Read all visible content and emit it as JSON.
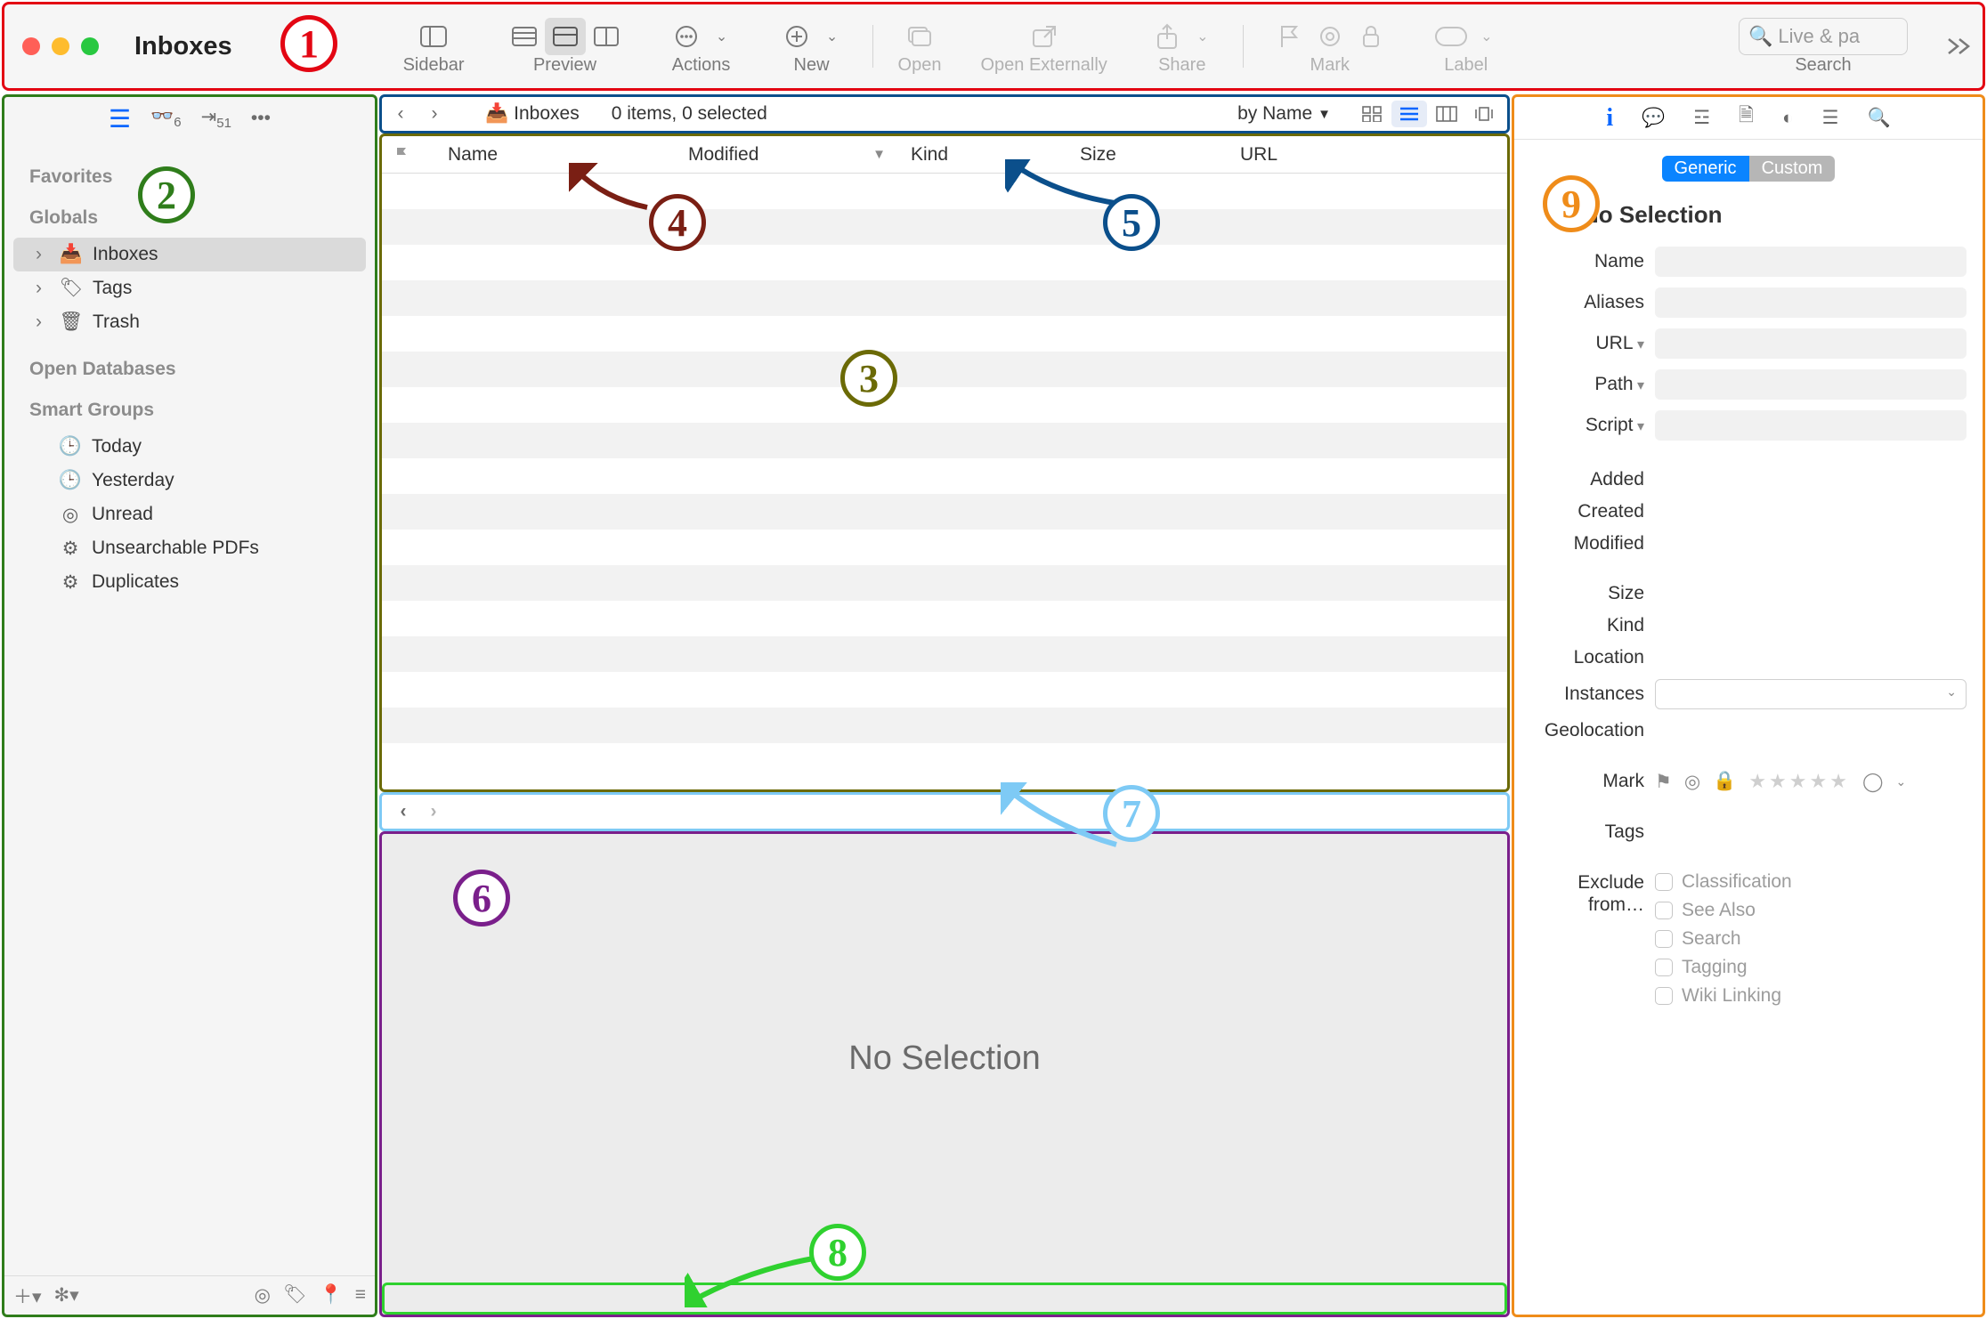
{
  "window": {
    "title": "Inboxes"
  },
  "toolbar": {
    "sidebar": "Sidebar",
    "preview": "Preview",
    "actions": "Actions",
    "new": "New",
    "open": "Open",
    "open_ext": "Open Externally",
    "share": "Share",
    "mark": "Mark",
    "label": "Label",
    "search": "Search",
    "search_placeholder": "Live & pa"
  },
  "sidebar_tabs": {
    "badge1": "6",
    "badge2": "51"
  },
  "sidebar": {
    "favorites": "Favorites",
    "globals": "Globals",
    "globals_items": [
      {
        "label": "Inboxes",
        "icon": "inbox",
        "disclosure": true,
        "selected": true
      },
      {
        "label": "Tags",
        "icon": "tag",
        "disclosure": true,
        "selected": false
      },
      {
        "label": "Trash",
        "icon": "trash",
        "disclosure": true,
        "selected": false
      }
    ],
    "open_db": "Open Databases",
    "smart": "Smart Groups",
    "smart_items": [
      {
        "label": "Today",
        "icon": "clock"
      },
      {
        "label": "Yesterday",
        "icon": "clock"
      },
      {
        "label": "Unread",
        "icon": "circle"
      },
      {
        "label": "Unsearchable PDFs",
        "icon": "gear"
      },
      {
        "label": "Duplicates",
        "icon": "gear"
      }
    ]
  },
  "pathbar": {
    "crumb": "Inboxes",
    "status": "0 items, 0 selected",
    "sort": "by Name"
  },
  "columns": {
    "flag": "",
    "name": "Name",
    "modified": "Modified",
    "kind": "Kind",
    "size": "Size",
    "url": "URL"
  },
  "preview": {
    "no_selection": "No Selection"
  },
  "inspector": {
    "generic": "Generic",
    "custom": "Custom",
    "title": "No Selection",
    "fields": {
      "name": "Name",
      "aliases": "Aliases",
      "url": "URL",
      "path": "Path",
      "script": "Script",
      "added": "Added",
      "created": "Created",
      "modified": "Modified",
      "size": "Size",
      "kind": "Kind",
      "location": "Location",
      "instances": "Instances",
      "geolocation": "Geolocation",
      "mark": "Mark",
      "tags": "Tags",
      "exclude": "Exclude from…"
    },
    "exclude_opts": [
      "Classification",
      "See Also",
      "Search",
      "Tagging",
      "Wiki Linking"
    ]
  },
  "annotations": {
    "1": "1",
    "2": "2",
    "3": "3",
    "4": "4",
    "5": "5",
    "6": "6",
    "7": "7",
    "8": "8",
    "9": "9"
  }
}
